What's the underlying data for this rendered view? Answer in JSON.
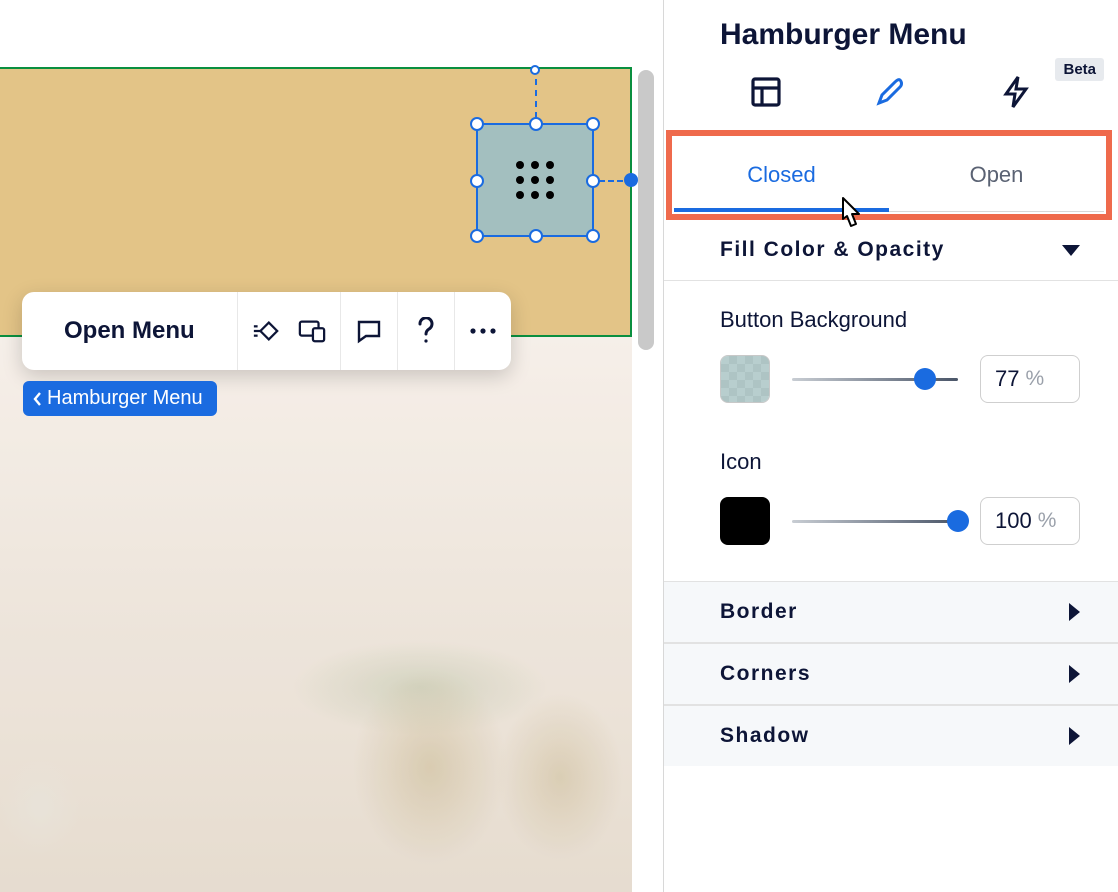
{
  "panel": {
    "title": "Hamburger Menu",
    "beta_badge": "Beta",
    "tabs": {
      "closed": "Closed",
      "open": "Open"
    },
    "sections": {
      "fill": {
        "title": "Fill Color & Opacity",
        "button_background": {
          "label": "Button Background",
          "opacity": "77",
          "unit": "%",
          "color": "#a3bfbf"
        },
        "icon": {
          "label": "Icon",
          "opacity": "100",
          "unit": "%",
          "color": "#000000"
        }
      },
      "border": {
        "title": "Border"
      },
      "corners": {
        "title": "Corners"
      },
      "shadow": {
        "title": "Shadow"
      }
    }
  },
  "toolbar": {
    "open_menu": "Open Menu"
  },
  "breadcrumb": {
    "label": "Hamburger Menu"
  }
}
